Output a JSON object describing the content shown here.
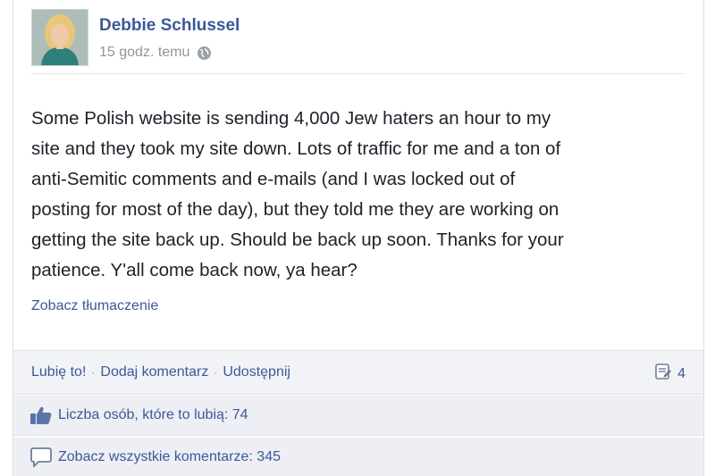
{
  "post": {
    "author": "Debbie Schlussel",
    "timestamp": "15 godz. temu",
    "privacy_icon": "globe-icon",
    "text": "Some Polish website is sending 4,000 Jew haters an hour to my\nsite and they took my site down. Lots of traffic for me and a ton of\nanti-Semitic comments and e-mails (and I was locked out of\nposting for most of the day), but they told me they are working on\ngetting the site back up. Should be back up soon. Thanks for your\npatience. Y'all come back now, ya hear?",
    "see_translation": "Zobacz tłumaczenie"
  },
  "actions": {
    "like": "Lubię to!",
    "comment": "Dodaj komentarz",
    "share": "Udostępnij",
    "separator": "·",
    "share_count": "4"
  },
  "likes": {
    "text": "Liczba osób, które to lubią: 74"
  },
  "comments": {
    "text": "Zobacz wszystkie komentarze: 345"
  },
  "colors": {
    "link": "#3b5998",
    "muted": "#90949c",
    "bar_bg": "#edeff4"
  }
}
